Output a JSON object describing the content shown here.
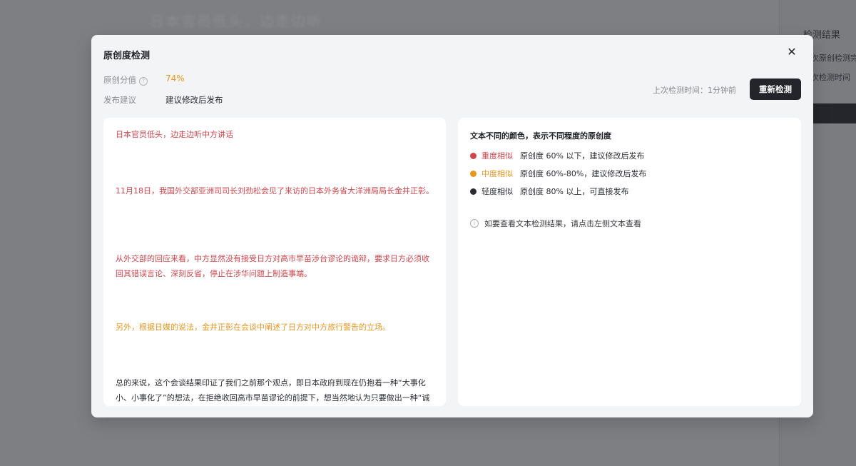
{
  "background": {
    "right_panel": {
      "title": "检测结果",
      "line1": "次原创检测完",
      "line2": "次检测时间"
    }
  },
  "modal": {
    "title": "原创度检测",
    "score_label": "原创分值",
    "score_value": "74%",
    "advice_label": "发布建议",
    "advice_value": "建议修改后发布",
    "last_check": "上次检测时间：1分钟前",
    "recheck_label": "重新检测"
  },
  "article": [
    {
      "text": "日本官员低头，边走边听中方讲话",
      "level": "heavy"
    },
    {
      "text": "11月18日，我国外交部亚洲司司长刘劲松会见了来访的日本外务省大洋洲局局长金井正彰。",
      "level": "heavy"
    },
    {
      "text": "从外交部的回应来看，中方显然没有接受日方对高市早苗涉台谬论的诡辩，要求日方必须收回其错误言论、深刻反省，停止在涉华问题上制造事端。",
      "level": "heavy"
    },
    {
      "text": "另外，根据日媒的说法，金井正彰在会谈中阐述了日方对中方旅行警告的立场。",
      "level": "mid"
    },
    {
      "text": "总的来说，这个会谈结果印证了我们之前那个观点，即日本政府到现在仍抱着一种“大事化小、小事化了”的想法，在拒绝收回高市早苗谬论的前提下，想当然地认为只要做出一种“诚意”以上的回应姿态，就能平息中方的怒火。",
      "level": "light"
    }
  ],
  "legend": {
    "title": "文本不同的颜色，表示不同程度的原创度",
    "items": [
      {
        "name": "重度相似",
        "desc": "原创度 60% 以下，建议修改后发布",
        "color": "#d0454c"
      },
      {
        "name": "中度相似",
        "desc": "原创度 60%-80%，建议修改后发布",
        "color": "#e8961e"
      },
      {
        "name": "轻度相似",
        "desc": "原创度 80% 以上，可直接发布",
        "color": "#2a2c31"
      }
    ],
    "info": "如要查看文本检测结果，请点击左侧文本查看"
  }
}
